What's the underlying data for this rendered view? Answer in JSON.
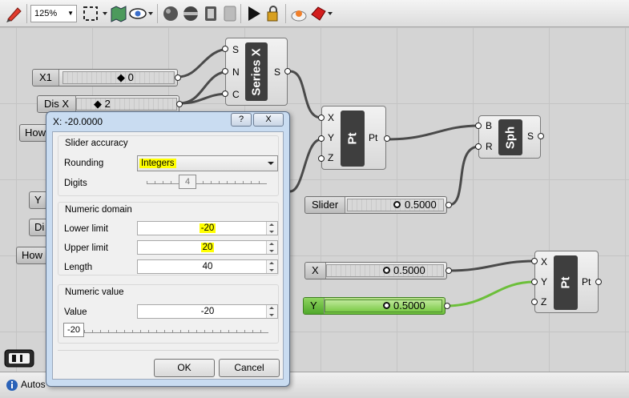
{
  "toolbar": {
    "zoom_value": "125%"
  },
  "canvas": {
    "series": {
      "title": "Series X",
      "inputs": [
        "S",
        "N",
        "C"
      ],
      "output": "S"
    },
    "pt1": {
      "title": "Pt",
      "inputs": [
        "X",
        "Y",
        "Z"
      ],
      "output": "Pt"
    },
    "sph": {
      "title": "Sph",
      "inputs": [
        "B",
        "R"
      ],
      "output": "S"
    },
    "pt2": {
      "title": "Pt",
      "inputs": [
        "X",
        "Y",
        "Z"
      ],
      "output": "Pt"
    },
    "sliders": {
      "x1": {
        "name": "X1",
        "value": "0"
      },
      "disx": {
        "name": "Dis X",
        "value": "2"
      },
      "radius": {
        "name": "Slider",
        "value": "0.5000"
      },
      "x": {
        "name": "X",
        "value": "0.5000"
      },
      "y": {
        "name": "Y",
        "value": "0.5000"
      }
    },
    "partial": {
      "how1": "How",
      "y": "Y",
      "di": "Di",
      "how2": "How"
    }
  },
  "status": {
    "text": "Autos"
  },
  "dialog": {
    "title": "X: -20.0000",
    "help_label": "?",
    "close_label": "X",
    "accuracy": {
      "heading": "Slider accuracy",
      "rounding_label": "Rounding",
      "rounding_value": "Integers",
      "digits_label": "Digits",
      "digits_value": "4"
    },
    "domain": {
      "heading": "Numeric domain",
      "lower_label": "Lower limit",
      "lower_value": "-20",
      "upper_label": "Upper limit",
      "upper_value": "20",
      "length_label": "Length",
      "length_value": "40"
    },
    "numeric": {
      "heading": "Numeric value",
      "value_label": "Value",
      "value": "-20",
      "slider_readout": "-20"
    },
    "ok_label": "OK",
    "cancel_label": "Cancel"
  },
  "colors": {
    "highlight": "#ffff00",
    "selected_slider": "#6cbf3a",
    "component_core": "#3e3e3e",
    "dialog_frame": "#c9dcf1"
  }
}
